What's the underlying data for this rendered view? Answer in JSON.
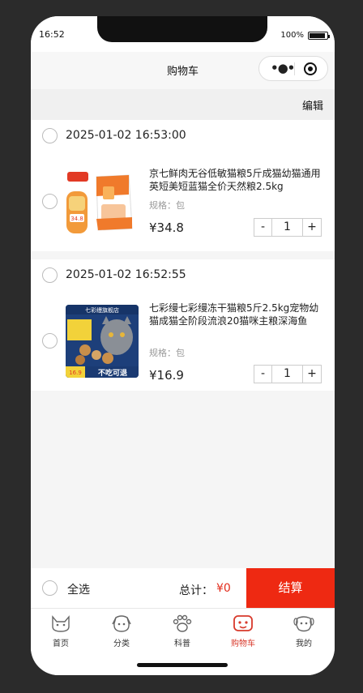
{
  "status": {
    "time": "16:52",
    "battery": "100%"
  },
  "navbar": {
    "title": "购物车"
  },
  "edit_label": "编辑",
  "cart": [
    {
      "date": "2025-01-02 16:53:00",
      "title": "京七鲜肉无谷低敏猫粮5斤成猫幼猫通用英短美短蓝猫全价天然粮2.5kg",
      "spec": "规格：包",
      "price": "¥34.8",
      "qty": "1",
      "stepper_minus": "-",
      "stepper_plus": "+",
      "image_label": "34.8"
    },
    {
      "date": "2025-01-02 16:52:55",
      "title": "七彩缦七彩缦冻干猫粮5斤2.5kg宠物幼猫成猫全阶段流浪20猫咪主粮深海鱼",
      "spec": "规格：包",
      "price": "¥16.9",
      "qty": "1",
      "stepper_minus": "-",
      "stepper_plus": "+",
      "image_label_top": "七彩缦旗舰店",
      "image_label_bottom": "不吃可退",
      "image_label_price": "16.9"
    }
  ],
  "footer": {
    "select_all": "全选",
    "total_label": "总计：",
    "total_value": "¥0",
    "checkout": "结算"
  },
  "tabs": [
    {
      "label": "首页",
      "icon": "cat-icon"
    },
    {
      "label": "分类",
      "icon": "dog-icon"
    },
    {
      "label": "科普",
      "icon": "paw-icon"
    },
    {
      "label": "购物车",
      "icon": "cart-icon",
      "active": true
    },
    {
      "label": "我的",
      "icon": "puppy-icon"
    }
  ],
  "colors": {
    "accent": "#ee2912",
    "price_red": "#e22b1b",
    "active_tab": "#d8392b"
  }
}
